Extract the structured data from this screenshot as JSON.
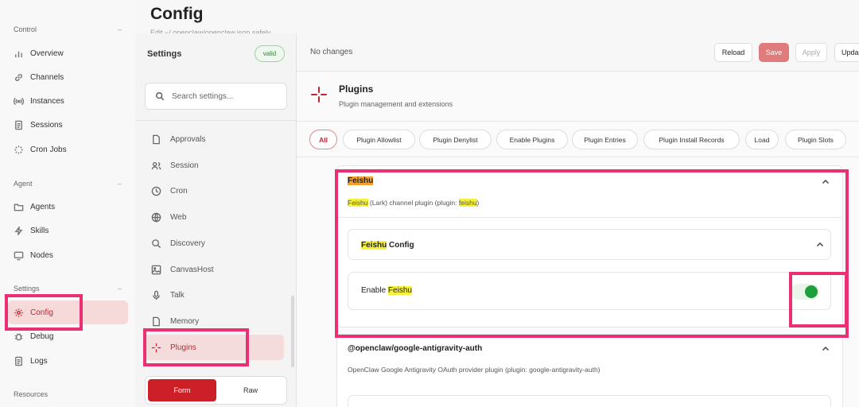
{
  "nav": {
    "sections": [
      {
        "label": "Control",
        "items": [
          "Overview",
          "Channels",
          "Instances",
          "Sessions",
          "Cron Jobs"
        ]
      },
      {
        "label": "Agent",
        "items": [
          "Agents",
          "Skills",
          "Nodes"
        ]
      },
      {
        "label": "Settings",
        "items": [
          "Config",
          "Debug",
          "Logs"
        ]
      },
      {
        "label": "Resources"
      }
    ],
    "collapse_glyph": "–",
    "active": "Config"
  },
  "header": {
    "title": "Config",
    "subtitle": "Edit ~/.openclaw/openclaw.json safely"
  },
  "settings": {
    "title": "Settings",
    "badge": "valid",
    "search_placeholder": "Search settings...",
    "items": [
      "Approvals",
      "Session",
      "Cron",
      "Web",
      "Discovery",
      "CanvasHost",
      "Talk",
      "Memory",
      "Plugins"
    ],
    "active": "Plugins",
    "mode": {
      "form": "Form",
      "raw": "Raw"
    }
  },
  "toolbar": {
    "status": "No changes",
    "reload": "Reload",
    "save": "Save",
    "apply": "Apply",
    "update": "Upda"
  },
  "plugins": {
    "title": "Plugins",
    "description": "Plugin management and extensions",
    "tabs": [
      "All",
      "Plugin Allowlist",
      "Plugin Denylist",
      "Enable Plugins",
      "Plugin Entries",
      "Plugin Install Records",
      "Load",
      "Plugin Slots"
    ],
    "active_tab": "All"
  },
  "feishu": {
    "title": "Feishu",
    "desc_prefix": "Feishu",
    "desc_mid": " (Lark) channel plugin (plugin: ",
    "desc_id": "feishu",
    "desc_suffix": ")",
    "config_hl": "Feishu",
    "config_rest": " Config",
    "enable_prefix": "Enable ",
    "enable_hl": "Feishu",
    "enabled": true
  },
  "google": {
    "title": "@openclaw/google-antigravity-auth",
    "description": "OpenClaw Google Antigravity OAuth provider plugin (plugin: google-antigravity-auth)"
  },
  "colors": {
    "accent": "#c0252e",
    "toggle_on": "#1f9e3c",
    "annotation": "#ea2f72",
    "highlight": "#f6f23a"
  }
}
